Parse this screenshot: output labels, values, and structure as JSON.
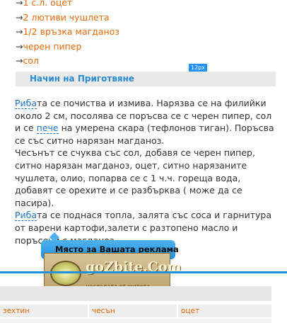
{
  "ingredients": [
    {
      "arrow": "→",
      "text": "1 с.л. оцет"
    },
    {
      "arrow": "→",
      "text": "2 лютиви чушлета"
    },
    {
      "arrow": "→",
      "text": "1/2 връзка магданоз"
    },
    {
      "arrow": "→",
      "text": "черен пипер"
    },
    {
      "arrow": "→",
      "text": "сол"
    }
  ],
  "spacing_badge": "12px",
  "section": {
    "title": "Начин на Приготвяне"
  },
  "instructions": {
    "p1_link": "Риба",
    "p1_a": "та се почиства и измива. Нарязва се на филийки около 2 см, посолява се поръсва се с черен пипер, сол и се ",
    "p1_link2": "пече",
    "p1_b": " на умерена скара (тефлонов тиган). Поръсва се със ситно нарязан магданоз.",
    "p2": "Чесънът се счуква със сол, добавя се черен пипер, ситно нарязан магданоз, оцет, ситно нарязаните чушлета, олио, попарва се с 1 ч.ч. гореща вода, добавят се орехите и се разбърква ( може да се пасира).",
    "p3_link": "Риба",
    "p3_a": "та се поднася топла, залята със соса и гарнитура от варени картофи,залети с разтопено масло и поръсени с магданоз."
  },
  "ad": {
    "label": "Място за Вашата реклама"
  },
  "logo": {
    "brand": "goZbite.Com",
    "tagline": "насладата от живота"
  },
  "table": {
    "cells": [
      "зехтин",
      "чесън",
      "оцет"
    ]
  },
  "colors": {
    "accent_orange": "#e86a0a",
    "accent_blue": "#1e8fdc",
    "link_blue": "#1e73c8"
  }
}
